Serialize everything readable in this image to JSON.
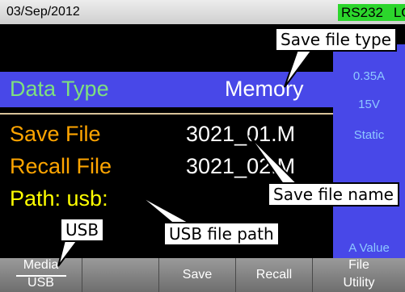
{
  "status_bar": {
    "date": "03/Sep/2012",
    "badges": [
      "RS232",
      "LOAD"
    ],
    "badge_color": "#2cd62c"
  },
  "side_panel": {
    "current": "0.35A",
    "voltage": "15V",
    "mode": "Static",
    "footer": "A Value",
    "color": "#4848e8"
  },
  "main": {
    "data_type": {
      "label": "Data Type",
      "value": "Memory"
    },
    "save_file": {
      "label": "Save File",
      "value": "3021_01.M"
    },
    "recall_file": {
      "label": "Recall File",
      "value": "3021_02.M"
    },
    "path": "Path: usb:"
  },
  "softkeys": {
    "media": {
      "line1": "Media",
      "line2": "USB"
    },
    "save": "Save",
    "recall": "Recall",
    "file_utility": {
      "line1": "File",
      "line2": "Utility"
    }
  },
  "callouts": {
    "save_file_type": "Save file type",
    "save_file_name": "Save file name",
    "usb_file_path": "USB file path",
    "usb": "USB"
  }
}
